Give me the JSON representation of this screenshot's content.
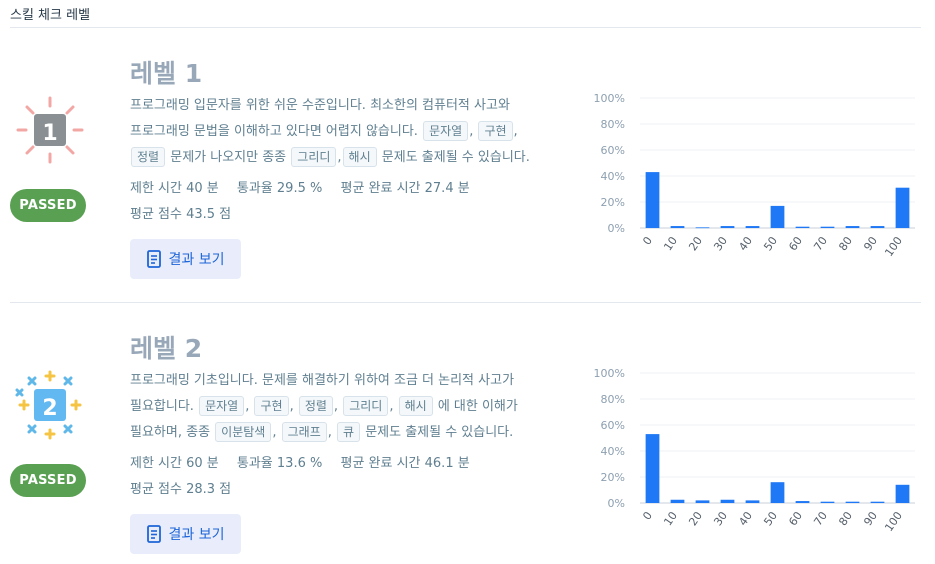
{
  "page": {
    "title": "스킬 체크 레벨"
  },
  "levels": [
    {
      "title": "레벨 1",
      "badge_number": "1",
      "status": "PASSED",
      "desc": {
        "line1": "프로그래밍 입문자를 위한 쉬운 수준입니다. 최소한의 컴퓨터적 사고와",
        "line2": "프로그래밍 문법을 이해하고 있다면 어렵지 않습니다.",
        "tags_a": [
          "문자열",
          "구현",
          "정렬"
        ],
        "mid": "문제가 나오지만 종종",
        "tags_b": [
          "그리디",
          "해시"
        ],
        "end": "문제도 출제될 수 있습니다."
      },
      "stats": {
        "time_limit": "제한 시간 40 분",
        "pass_rate": "통과율 29.5 %",
        "avg_time": "평균 완료 시간 27.4 분",
        "avg_score": "평균 점수 43.5 점"
      },
      "button_label": "결과 보기"
    },
    {
      "title": "레벨 2",
      "badge_number": "2",
      "status": "PASSED",
      "desc": {
        "line1": "프로그래밍 기초입니다. 문제를 해결하기 위하여 조금 더 논리적 사고가",
        "line2_pre": "필요합니다.",
        "tags_a": [
          "문자열",
          "구현",
          "정렬",
          "그리디",
          "해시"
        ],
        "line2_post": "에 대한 이해가",
        "line3_pre": "필요하며, 종종",
        "tags_b": [
          "이분탐색",
          "그래프",
          "큐"
        ],
        "end": "문제도 출제될 수 있습니다."
      },
      "stats": {
        "time_limit": "제한 시간 60 분",
        "pass_rate": "통과율 13.6 %",
        "avg_time": "평균 완료 시간 46.1 분",
        "avg_score": "평균 점수 28.3 점"
      },
      "button_label": "결과 보기"
    }
  ],
  "colors": {
    "bar": "#1f78f5",
    "passed": "#5aa053",
    "button_text": "#1d65d8"
  },
  "icons": {
    "result_button": "document-icon"
  },
  "chart_data": [
    {
      "type": "bar",
      "categories": [
        "0",
        "10",
        "20",
        "30",
        "40",
        "50",
        "60",
        "70",
        "80",
        "90",
        "100"
      ],
      "values": [
        43,
        1.5,
        0.5,
        1.5,
        1.5,
        17,
        1,
        1,
        1.5,
        1.5,
        31
      ],
      "ylim": [
        0,
        100
      ],
      "yticks": [
        "0%",
        "20%",
        "40%",
        "60%",
        "80%",
        "100%"
      ],
      "grid": true
    },
    {
      "type": "bar",
      "categories": [
        "0",
        "10",
        "20",
        "30",
        "40",
        "50",
        "60",
        "70",
        "80",
        "90",
        "100"
      ],
      "values": [
        53,
        2.5,
        2,
        2.5,
        2,
        16,
        1.5,
        1,
        1,
        1,
        14
      ],
      "ylim": [
        0,
        100
      ],
      "yticks": [
        "0%",
        "20%",
        "40%",
        "60%",
        "80%",
        "100%"
      ],
      "grid": true
    }
  ]
}
